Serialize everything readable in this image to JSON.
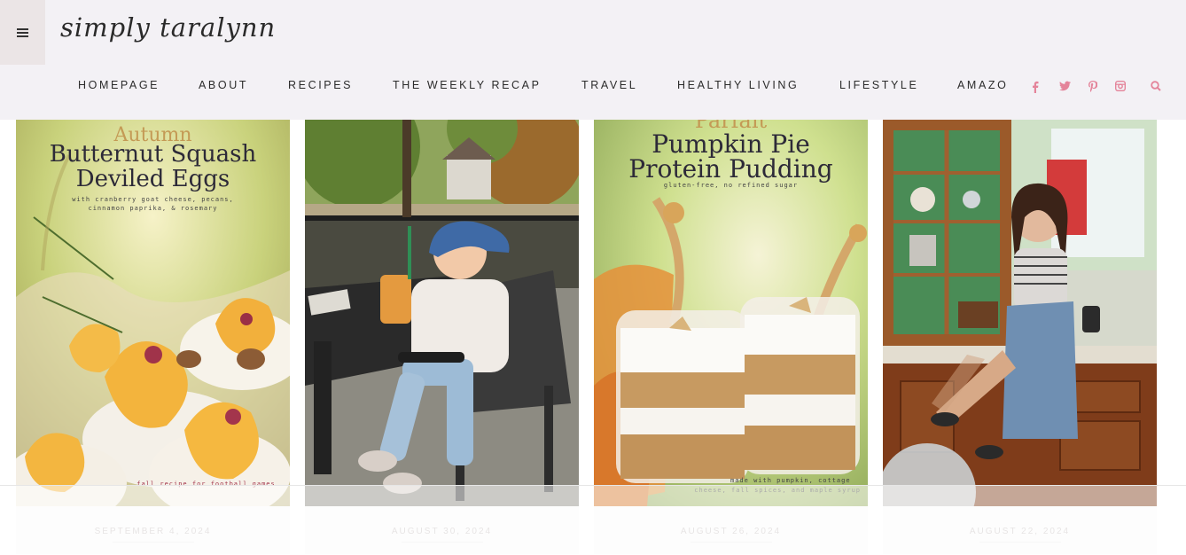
{
  "header": {
    "logo": "simply taralynn",
    "nav": [
      "HOMEPAGE",
      "ABOUT",
      "RECIPES",
      "THE WEEKLY RECAP",
      "TRAVEL",
      "HEALTHY LIVING",
      "LIFESTYLE",
      "AMAZO"
    ],
    "social_icons": [
      "facebook-icon",
      "twitter-icon",
      "pinterest-icon",
      "instagram-icon",
      "search-icon"
    ],
    "accent_color": "#e4849a"
  },
  "posts": [
    {
      "date": "SEPTEMBER 4, 2024",
      "image_text": {
        "kicker": "Autumn",
        "title_line1": "Butternut Squash",
        "title_line2": "Deviled Eggs",
        "subtitle": "with cranberry goat cheese, pecans,",
        "subtitle2": "cinnamon paprika, & rosemary",
        "footer": "fall recipe for football games"
      }
    },
    {
      "date": "AUGUST 30, 2024"
    },
    {
      "date": "AUGUST 26, 2024",
      "image_text": {
        "kicker": "Parfait",
        "title_line1": "Pumpkin Pie",
        "title_line2": "Protein Pudding",
        "subtitle": "gluten-free, no refined sugar",
        "footer": "made with pumpkin, cottage",
        "footer2": "cheese, fall spices, and maple syrup"
      }
    },
    {
      "date": "AUGUST 22, 2024"
    }
  ]
}
